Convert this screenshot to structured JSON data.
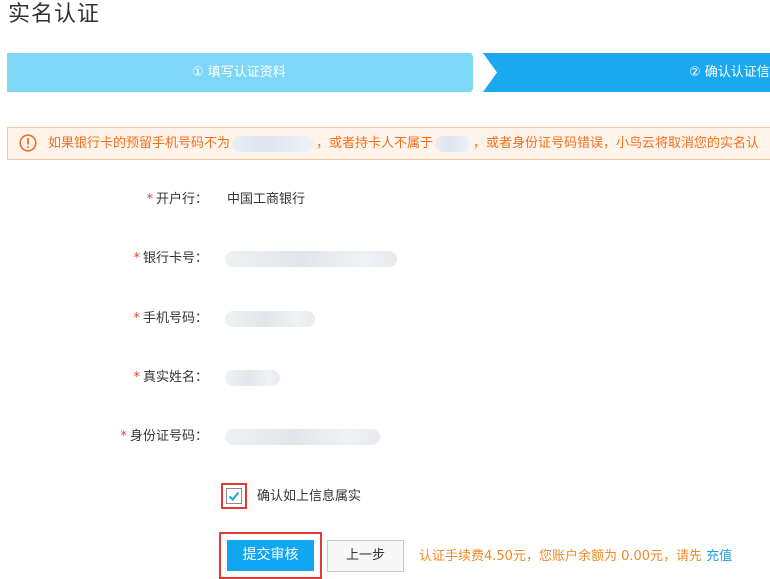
{
  "page": {
    "title": "实名认证"
  },
  "steps": [
    {
      "label": "① 填写认证资料"
    },
    {
      "label": "② 确认认证信"
    }
  ],
  "warning": {
    "icon": "exclamation-circle-icon",
    "part1": "如果银行卡的预留手机号码不为",
    "part2": "，或者持卡人不属于",
    "part3": "，或者身份证号码错误，小鸟云将取消您的实名认"
  },
  "form": {
    "bank": {
      "label": "开户行：",
      "value": "中国工商银行"
    },
    "card": {
      "label": "银行卡号："
    },
    "phone": {
      "label": "手机号码："
    },
    "name": {
      "label": "真实姓名："
    },
    "idcard": {
      "label": "身份证号码："
    },
    "required_mark": "*"
  },
  "confirm": {
    "label": "确认如上信息属实",
    "checked": true
  },
  "buttons": {
    "submit": "提交审核",
    "back": "上一步"
  },
  "fee": {
    "text": "认证手续费4.50元，您账户余额为 0.00元，请先",
    "link": "充值"
  },
  "colors": {
    "accent": "#11a6f1",
    "warning": "#f07020",
    "highlight_border": "#e23a35"
  }
}
